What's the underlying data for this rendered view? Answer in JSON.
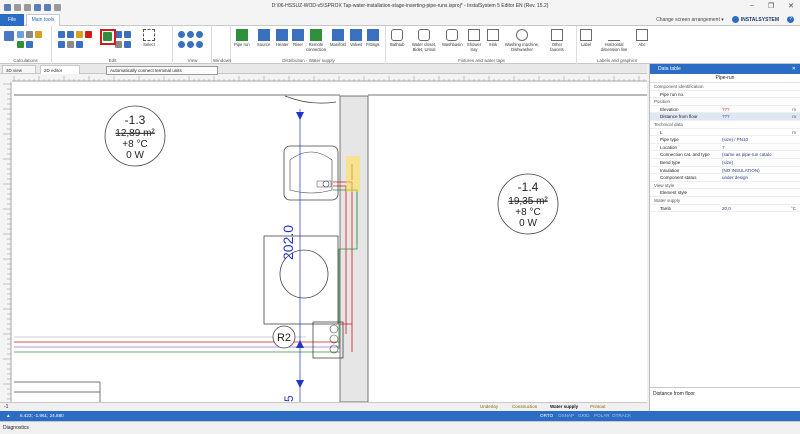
{
  "window": {
    "title": "D:\\06-HSSUZ-WOD-v5\\SPROX Tap-water-installation-stage-inserting-pipe-runs.isproj* - InstalSystem 5 Editor EN (Rev. 15.2)",
    "controls": [
      "–",
      "❐",
      "✕"
    ]
  },
  "tabs": {
    "file": "File",
    "main": "Main tools",
    "change_arrangement": "Change screen arrangement ▾",
    "logo": "INSTALSYSTEM",
    "help": "?"
  },
  "ribbon": {
    "groups": [
      {
        "label": "Calculations"
      },
      {
        "label": "Edit"
      },
      {
        "label": "View"
      },
      {
        "label": "Windows"
      },
      {
        "label": "Distribution - Water supply"
      },
      {
        "label": "Fixtures and water taps"
      },
      {
        "label": "Labels and graphics"
      }
    ],
    "select_label": "Select",
    "buttons": [
      {
        "label": "Pipe run",
        "color": "#2f8f3a"
      },
      {
        "label": "Source",
        "color": "#3b6fbf"
      },
      {
        "label": "Heater",
        "color": "#3b6fbf"
      },
      {
        "label": "Riser",
        "color": "#3b6fbf"
      },
      {
        "label": "Remote connection",
        "color": "#2f8f3a"
      },
      {
        "label": "Manifold",
        "color": "#3b6fbf"
      },
      {
        "label": "Valves",
        "color": "#3b6fbf"
      },
      {
        "label": "Fittings",
        "color": "#3b6fbf"
      },
      {
        "label": "Bathtub",
        "color": "#6a6a6a"
      },
      {
        "label": "Water closet, Bidet, Urinal",
        "color": "#6a6a6a"
      },
      {
        "label": "Washbasin",
        "color": "#6a6a6a"
      },
      {
        "label": "Shower tray",
        "color": "#6a6a6a"
      },
      {
        "label": "Sink",
        "color": "#6a6a6a"
      },
      {
        "label": "Washing machine, Dishwasher",
        "color": "#6a6a6a"
      },
      {
        "label": "Other faucets",
        "color": "#6a6a6a"
      },
      {
        "label": "Label",
        "color": "#6a6a6a"
      },
      {
        "label": "Horizontal dimension line",
        "color": "#6a6a6a"
      },
      {
        "label": "Abc",
        "color": "#6a6a6a"
      }
    ],
    "tooltip": "Automatically connect terminal units"
  },
  "doc_tabs": [
    "3D view",
    "2D editor"
  ],
  "drawing": {
    "rooms": [
      {
        "temp_top": "-1.3",
        "area": "12,89 m²",
        "temp": "+8 °C",
        "power": "0 W"
      },
      {
        "temp_top": "-1.4",
        "area": "19,35 m²",
        "temp": "+8 °C",
        "power": "0 W"
      }
    ],
    "dimension": "202.0",
    "riser_label": "R2",
    "bottom_dim": "5"
  },
  "bottom_bar": {
    "level": "-1",
    "layers": [
      "Underlay",
      "Construction",
      "Water supply",
      "Printout"
    ]
  },
  "status": {
    "coords": "6.423; -1.961; 24.880",
    "modes": [
      "ORTO",
      "OSNAP",
      "GRID",
      "POLAR",
      "OTRACK"
    ]
  },
  "diagnostics": "Diagnostics",
  "data_table": {
    "title": "Data table",
    "subtitle": "Pipe-run",
    "rows": [
      {
        "type": "section",
        "label": "Component identification"
      },
      {
        "type": "row",
        "key": "Pipe run no.",
        "value": "",
        "unit": ""
      },
      {
        "type": "section",
        "label": "Position"
      },
      {
        "type": "row",
        "key": "Elevation",
        "value": "???",
        "unit": "m",
        "red": true
      },
      {
        "type": "row",
        "key": "Distance from floor",
        "value": "???",
        "unit": "m",
        "selected": true
      },
      {
        "type": "section",
        "label": "Technical data"
      },
      {
        "type": "row",
        "key": "L",
        "value": "",
        "unit": "m"
      },
      {
        "type": "row",
        "key": "Pipe type",
        "value": "(size) / PN10",
        "unit": ""
      },
      {
        "type": "row",
        "key": "Location",
        "value": "?",
        "unit": ""
      },
      {
        "type": "row",
        "key": "Connection cat. and type",
        "value": "(same as pipe-run catalo",
        "unit": ""
      },
      {
        "type": "row",
        "key": "Bend type",
        "value": "(size)",
        "unit": ""
      },
      {
        "type": "row",
        "key": "Insulation",
        "value": "(NO INSULATION)",
        "unit": ""
      },
      {
        "type": "row",
        "key": "Component status",
        "value": "under design",
        "unit": ""
      },
      {
        "type": "section",
        "label": "View style"
      },
      {
        "type": "row",
        "key": "Element style",
        "value": "",
        "unit": ""
      },
      {
        "type": "section",
        "label": "Water supply"
      },
      {
        "type": "row",
        "key": "Tamb",
        "value": "20,0",
        "unit": "°C"
      }
    ],
    "footer": "Distance from floor"
  }
}
